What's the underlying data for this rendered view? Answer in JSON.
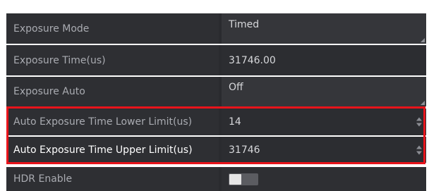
{
  "rows": [
    {
      "label": "Exposure Mode",
      "value": "Timed",
      "type": "combo"
    },
    {
      "label": "Exposure Time(us)",
      "value": "31746.00",
      "type": "text"
    },
    {
      "label": "Exposure Auto",
      "value": "Off",
      "type": "combo"
    },
    {
      "label": "Auto Exposure Time Lower Limit(us)",
      "value": "14",
      "type": "spin"
    },
    {
      "label": "Auto Exposure Time Upper Limit(us)",
      "value": "31746",
      "type": "spin"
    },
    {
      "label": "HDR Enable",
      "value": "",
      "type": "toggle",
      "toggle_state": "off"
    }
  ],
  "colors": {
    "highlight": "#e8141b",
    "label_bg": "#2e2f33",
    "value_bg": "#35363a"
  }
}
